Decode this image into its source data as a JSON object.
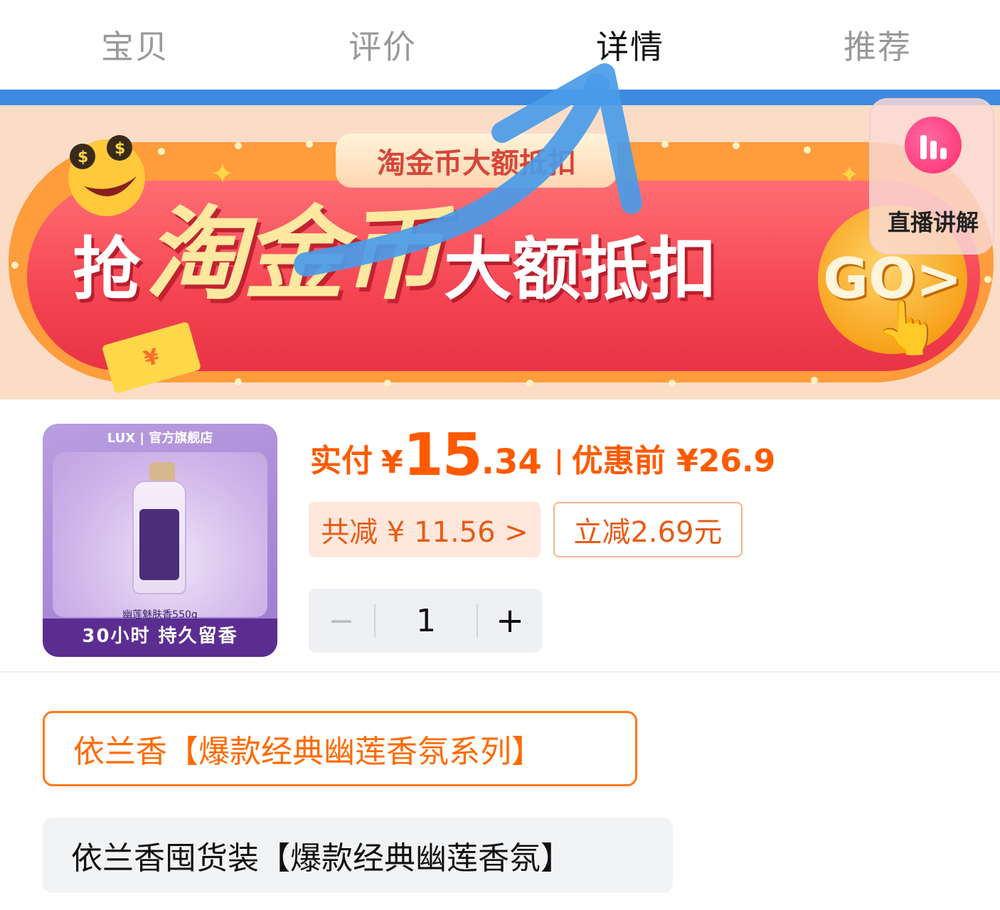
{
  "tabs": [
    {
      "label": "宝贝",
      "active": false
    },
    {
      "label": "评价",
      "active": false
    },
    {
      "label": "详情",
      "active": true
    },
    {
      "label": "推荐",
      "active": false
    }
  ],
  "banner": {
    "sub_tag": "淘金币大额抵扣",
    "headline_prefix": "抢",
    "headline_main": "淘金币",
    "headline_suffix": "大额抵扣",
    "go_label": "GO>",
    "coupon_mark": "¥"
  },
  "live": {
    "label": "直播讲解",
    "icon": "live-bars-icon"
  },
  "product": {
    "image": {
      "brand_line": "LUX | 官方旗舰店",
      "size_text": "幽莲魅肤香550g",
      "tagline": "30小时 持久留香"
    },
    "price": {
      "label": "实付",
      "currency": "¥",
      "integer": "15",
      "decimal": ".34",
      "original": "优惠前 ¥26.9"
    },
    "total_discount": "共减 ¥ 11.56 >",
    "instant_discount": "立减2.69元",
    "quantity": {
      "minus": "−",
      "value": "1",
      "plus": "+"
    }
  },
  "sku_options": [
    {
      "label": "依兰香【爆款经典幽莲香氛系列】",
      "selected": true
    },
    {
      "label": "依兰香囤货装【爆款经典幽莲香氛】",
      "selected": false
    }
  ],
  "colors": {
    "accent": "#ff5a00",
    "annotation_arrow": "#4a9be8",
    "banner_red": "#f44452",
    "tab_active": "#111111",
    "tab_inactive": "#999999"
  }
}
